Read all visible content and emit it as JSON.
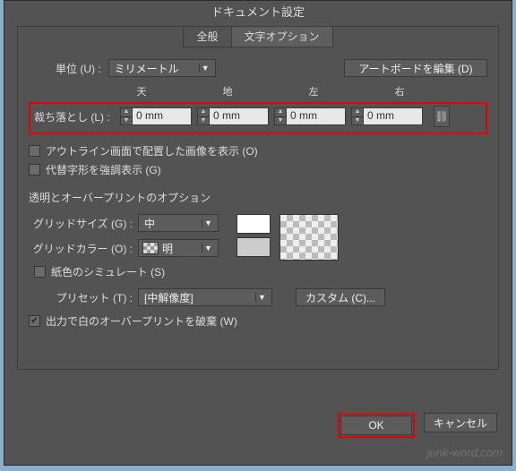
{
  "title": "ドキュメント設定",
  "tabs": {
    "general": "全般",
    "typo": "文字オプション"
  },
  "units": {
    "label": "単位 (U) :",
    "value": "ミリメートル"
  },
  "editArtboards": "アートボードを編集 (D)",
  "bleed": {
    "label": "裁ち落とし (L) :",
    "top_lbl": "天",
    "bottom_lbl": "地",
    "left_lbl": "左",
    "right_lbl": "右",
    "top": "0 mm",
    "bottom": "0 mm",
    "left": "0 mm",
    "right": "0 mm"
  },
  "chk_outline": "アウトライン画面で配置した画像を表示 (O)",
  "chk_altglyph": "代替字形を強調表示 (G)",
  "section_transp": "透明とオーバープリントのオプション",
  "gridsize": {
    "label": "グリッドサイズ (G) :",
    "value": "中"
  },
  "gridcolor": {
    "label": "グリッドカラー (O) :",
    "value": "明"
  },
  "chk_papersim": "紙色のシミュレート (S)",
  "preset": {
    "label": "プリセット (T) :",
    "value": "[中解像度]"
  },
  "custom_btn": "カスタム (C)...",
  "chk_discard": "出力で白のオーバープリントを破棄 (W)",
  "ok": "OK",
  "cancel": "キャンセル",
  "watermark": "junk-word.com"
}
